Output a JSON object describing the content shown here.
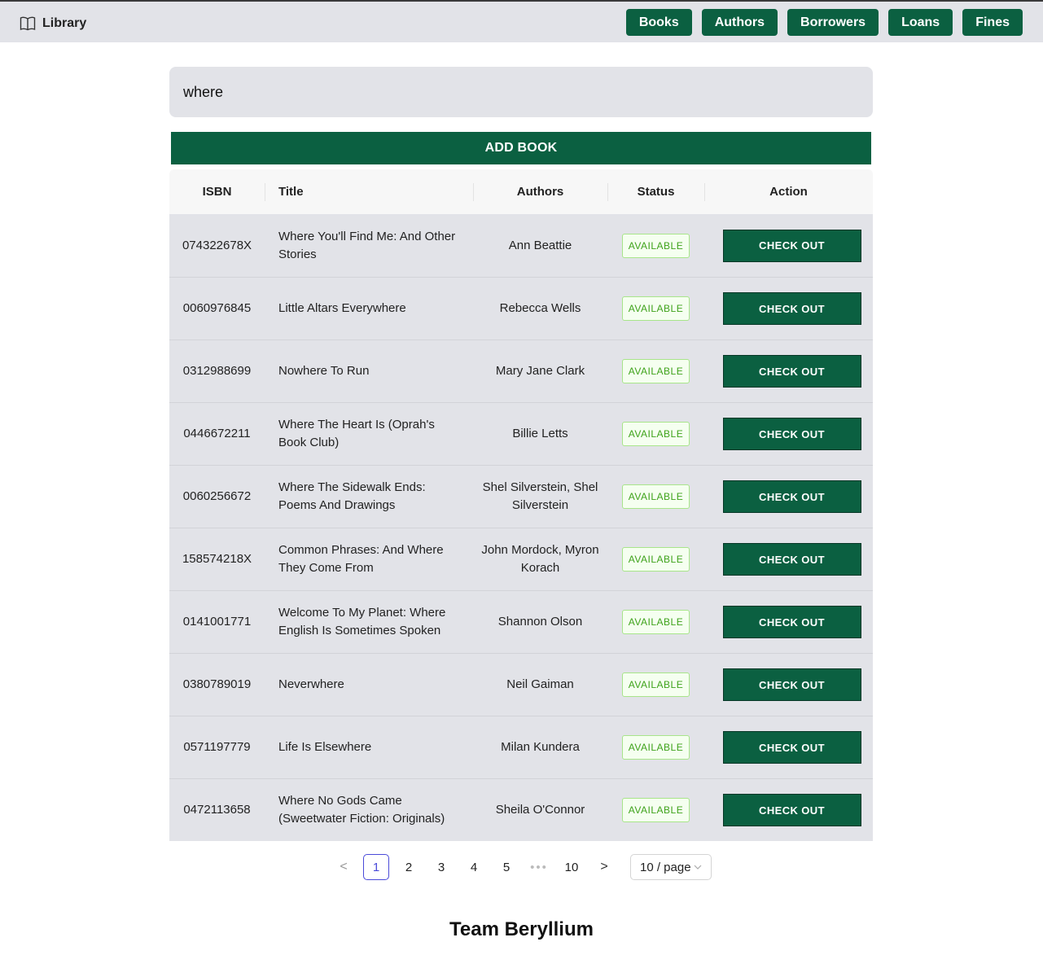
{
  "header": {
    "brand": "Library",
    "nav": [
      "Books",
      "Authors",
      "Borrowers",
      "Loans",
      "Fines"
    ]
  },
  "search": {
    "value": "where"
  },
  "add_button": "ADD BOOK",
  "table": {
    "columns": [
      "ISBN",
      "Title",
      "Authors",
      "Status",
      "Action"
    ],
    "rows": [
      {
        "isbn": "074322678X",
        "title": "Where You'll Find Me: And Other Stories",
        "authors": "Ann Beattie",
        "status": "AVAILABLE",
        "action": "CHECK OUT"
      },
      {
        "isbn": "0060976845",
        "title": "Little Altars Everywhere",
        "authors": "Rebecca Wells",
        "status": "AVAILABLE",
        "action": "CHECK OUT"
      },
      {
        "isbn": "0312988699",
        "title": "Nowhere To Run",
        "authors": "Mary Jane Clark",
        "status": "AVAILABLE",
        "action": "CHECK OUT"
      },
      {
        "isbn": "0446672211",
        "title": "Where The Heart Is (Oprah's Book Club)",
        "authors": "Billie Letts",
        "status": "AVAILABLE",
        "action": "CHECK OUT"
      },
      {
        "isbn": "0060256672",
        "title": "Where The Sidewalk Ends: Poems And Drawings",
        "authors": "Shel Silverstein, Shel Silverstein",
        "status": "AVAILABLE",
        "action": "CHECK OUT"
      },
      {
        "isbn": "158574218X",
        "title": "Common Phrases: And Where They Come From",
        "authors": "John Mordock, Myron Korach",
        "status": "AVAILABLE",
        "action": "CHECK OUT"
      },
      {
        "isbn": "0141001771",
        "title": "Welcome To My Planet: Where English Is Sometimes Spoken",
        "authors": "Shannon Olson",
        "status": "AVAILABLE",
        "action": "CHECK OUT"
      },
      {
        "isbn": "0380789019",
        "title": "Neverwhere",
        "authors": "Neil Gaiman",
        "status": "AVAILABLE",
        "action": "CHECK OUT"
      },
      {
        "isbn": "0571197779",
        "title": "Life Is Elsewhere",
        "authors": "Milan Kundera",
        "status": "AVAILABLE",
        "action": "CHECK OUT"
      },
      {
        "isbn": "0472113658",
        "title": "Where No Gods Came (Sweetwater Fiction: Originals)",
        "authors": "Sheila O'Connor",
        "status": "AVAILABLE",
        "action": "CHECK OUT"
      }
    ]
  },
  "pagination": {
    "prev": "<",
    "pages": [
      "1",
      "2",
      "3",
      "4",
      "5"
    ],
    "ellipsis": "•••",
    "last": "10",
    "next": ">",
    "current": "1",
    "page_size": "10 / page"
  },
  "footer": "Team Beryllium",
  "colors": {
    "primary": "#0b6041",
    "header_bg": "#e2e3e8",
    "badge_text": "#3ea21a",
    "badge_border": "#a8e58a",
    "active_page": "#4a4ad9"
  }
}
